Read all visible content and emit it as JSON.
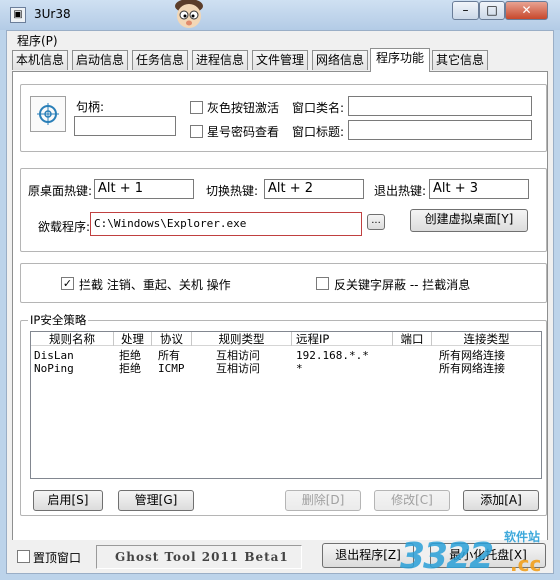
{
  "window": {
    "title": "3Ur38",
    "min": "–",
    "max": "□",
    "close": "✕"
  },
  "menu": {
    "program": "程序(P)"
  },
  "tabs": [
    "本机信息",
    "启动信息",
    "任务信息",
    "进程信息",
    "文件管理",
    "网络信息",
    "程序功能",
    "其它信息"
  ],
  "active_tab": 6,
  "handle_group": {
    "handle_label": "句柄:",
    "handle_value": "",
    "gray_button_activate": "灰色按钮激活",
    "star_password_view": "星号密码查看",
    "window_class_label": "窗口类名:",
    "window_class_value": "",
    "window_title_label": "窗口标题:",
    "window_title_value": ""
  },
  "hotkey_group": {
    "orig_desktop_label": "原桌面热键:",
    "orig_desktop_value": "Alt + 1",
    "switch_label": "切换热键:",
    "switch_value": "Alt + 2",
    "exit_label": "退出热键:",
    "exit_value": "Alt + 3",
    "load_program_label": "欲载程序:",
    "load_program_value": "C:\\Windows\\Explorer.exe",
    "browse_label": "...",
    "create_desktop_button": "创建虚拟桌面[Y]"
  },
  "intercept_group": {
    "intercept_checked": true,
    "intercept_label": "拦截 注销、重起、关机 操作",
    "reverse_checked": false,
    "reverse_label": "反关键字屏蔽 -- 拦截消息"
  },
  "ip_policy": {
    "title": "IP安全策略",
    "columns": [
      "规则名称",
      "处理",
      "协议",
      "规则类型",
      "远程IP",
      "端口",
      "连接类型"
    ],
    "rows": [
      [
        "DisLan",
        "拒绝",
        "所有",
        "互相访问",
        "192.168.*.*",
        "",
        "所有网络连接"
      ],
      [
        "NoPing",
        "拒绝",
        "ICMP",
        "互相访问",
        "*",
        "",
        "所有网络连接"
      ]
    ],
    "enable_button": "启用[S]",
    "manage_button": "管理[G]",
    "delete_button": "删除[D]",
    "modify_button": "修改[C]",
    "add_button": "添加[A]"
  },
  "statusbar": {
    "topmost_checked": false,
    "topmost_label": "置顶窗口",
    "version_text": "Ghost Tool 2011 Beta1",
    "exit_button": "退出程序[Z]",
    "minimize_button": "最小化托盘[X]"
  },
  "watermark": {
    "number": "3322",
    "domain": ".cc",
    "site": "软件站"
  }
}
